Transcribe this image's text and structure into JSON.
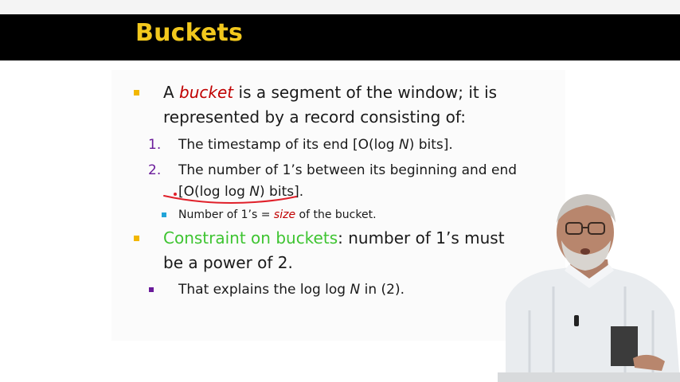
{
  "slide": {
    "title": "Buckets",
    "bullet1": {
      "line1_pre": "A ",
      "line1_em": "bucket",
      "line1_post": " is a segment of the window; it is",
      "line2": "represented by a record consisting of:"
    },
    "item1": {
      "num": "1.",
      "text_pre": "The timestamp of its end [O(log ",
      "text_em": "N",
      "text_post": ") bits]."
    },
    "item2": {
      "num": "2.",
      "line1": "The number of 1’s between its beginning and end",
      "line2_pre": "[O(log log ",
      "line2_em": "N",
      "line2_post": ") bits]."
    },
    "sub_item": {
      "pre": "Number of 1’s = ",
      "em": "size",
      "post": " of the bucket."
    },
    "bullet2": {
      "green": "Constraint on buckets",
      "rest": ": number of 1’s must",
      "line2": "be a power of 2."
    },
    "bullet3": {
      "pre": "That explains the log log ",
      "em": "N",
      "post": " in (2)."
    }
  },
  "colors": {
    "title": "#f2c81d",
    "title_bar": "#000000",
    "emphasis_red": "#c00000",
    "constraint_green": "#3ec431",
    "number_purple": "#6a1b9a",
    "bullet_yellow": "#f2b700",
    "bullet_cyan": "#21a4d8",
    "annotation_red": "#e0202a"
  }
}
